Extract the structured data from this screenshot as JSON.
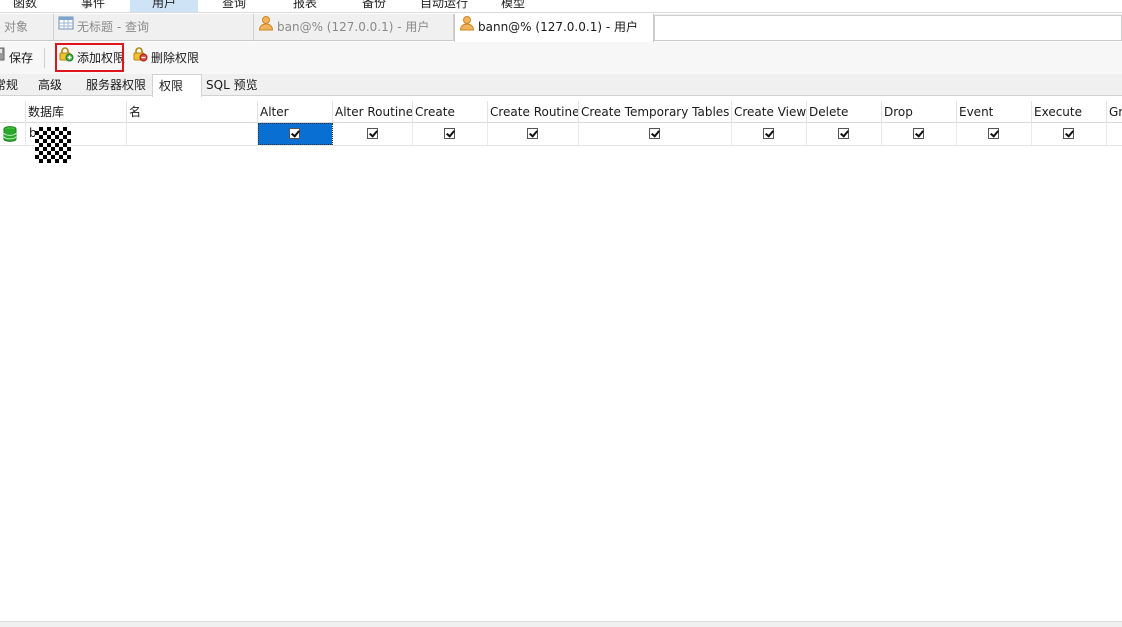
{
  "menu": {
    "items": [
      "函数",
      "事件",
      "用户",
      "查询",
      "报表",
      "备份",
      "自动运行",
      "模型"
    ],
    "active_index": 2
  },
  "tabs": {
    "objects_label": "对象",
    "query_tab": "无标题 - 查询",
    "user_tab_1": "ban@% (127.0.0.1) - 用户",
    "user_tab_2": "bann@% (127.0.0.1) - 用户"
  },
  "toolbar": {
    "save_label": "保存",
    "add_privilege_label": "添加权限",
    "delete_privilege_label": "删除权限"
  },
  "subtabs": {
    "general": "常规",
    "advanced": "高级",
    "server_privileges": "服务器权限",
    "privileges": "权限",
    "sql_preview": "SQL 预览"
  },
  "grid": {
    "columns": [
      "数据库",
      "名",
      "Alter",
      "Alter Routine",
      "Create",
      "Create Routine",
      "Create Temporary Tables",
      "Create View",
      "Delete",
      "Drop",
      "Event",
      "Execute",
      "Gr"
    ],
    "rows": [
      {
        "database": "b",
        "name": "",
        "checked": [
          true,
          true,
          true,
          true,
          true,
          true,
          true,
          true,
          true,
          true
        ]
      }
    ]
  },
  "colors": {
    "selection": "#0a6fd3",
    "highlight_box": "#e0141c",
    "active_menu": "#cfe3f7",
    "db_icon": "#2aa82a"
  }
}
